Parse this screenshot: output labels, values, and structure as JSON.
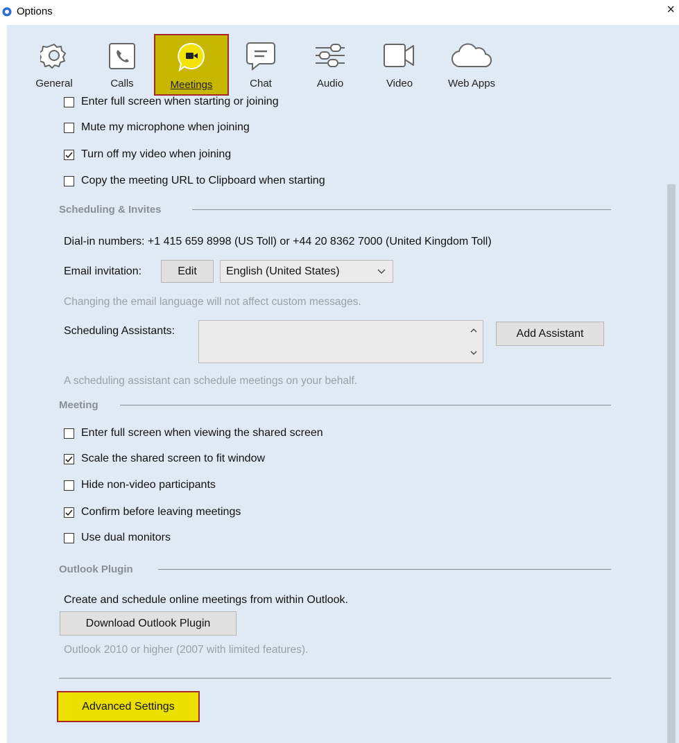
{
  "window": {
    "title": "Options",
    "close_glyph": "×"
  },
  "tabs": [
    {
      "label": "General",
      "icon": "gear-icon"
    },
    {
      "label": "Calls",
      "icon": "phone-icon"
    },
    {
      "label": "Meetings",
      "icon": "meeting-bubble-icon",
      "selected": true
    },
    {
      "label": "Chat",
      "icon": "chat-icon"
    },
    {
      "label": "Audio",
      "icon": "sliders-icon"
    },
    {
      "label": "Video",
      "icon": "video-camera-icon"
    },
    {
      "label": "Web Apps",
      "icon": "cloud-icon"
    }
  ],
  "join_options": [
    {
      "label": "Enter full screen when starting or joining",
      "checked": false
    },
    {
      "label": "Mute my microphone when joining",
      "checked": false
    },
    {
      "label": "Turn off my video when joining",
      "checked": true
    },
    {
      "label": "Copy the meeting URL to Clipboard when starting",
      "checked": false
    }
  ],
  "scheduling": {
    "title": "Scheduling & Invites",
    "dial_in": "Dial-in numbers: +1 415 659 8998 (US Toll) or +44 20 8362 7000 (United Kingdom Toll)",
    "email_label": "Email invitation:",
    "edit_label": "Edit",
    "language": "English (United States)",
    "language_hint": "Changing the email language will not affect custom messages.",
    "assistants_label": "Scheduling Assistants:",
    "add_assistant_label": "Add Assistant",
    "assistant_hint": "A scheduling assistant can schedule meetings on your behalf."
  },
  "meeting": {
    "title": "Meeting",
    "options": [
      {
        "label": "Enter full screen when viewing the shared screen",
        "checked": false
      },
      {
        "label": "Scale the shared screen to fit window",
        "checked": true
      },
      {
        "label": "Hide non-video participants",
        "checked": false
      },
      {
        "label": "Confirm before leaving meetings",
        "checked": true
      },
      {
        "label": "Use dual monitors",
        "checked": false
      }
    ]
  },
  "outlook": {
    "title": "Outlook Plugin",
    "description": "Create and schedule online meetings from within Outlook.",
    "download_label": "Download Outlook Plugin",
    "requirements": "Outlook 2010 or higher (2007 with limited features)."
  },
  "advanced_label": "Advanced Settings",
  "colors": {
    "panel": "#dfeaf4",
    "highlight": "#c7b700",
    "highlight_border": "#a52727"
  }
}
